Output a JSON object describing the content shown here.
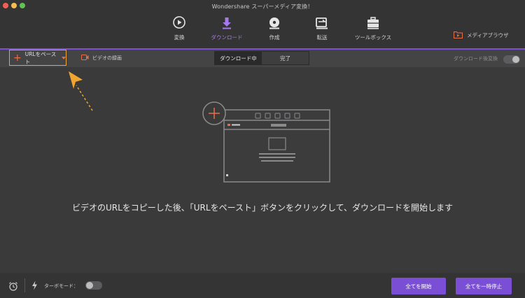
{
  "window": {
    "title": "Wondershare スーパーメディア変換！"
  },
  "tabs": [
    {
      "label": "変換",
      "icon": "convert-icon"
    },
    {
      "label": "ダウンロード",
      "icon": "download-icon",
      "active": true
    },
    {
      "label": "作成",
      "icon": "burn-disc-icon"
    },
    {
      "label": "転送",
      "icon": "transfer-icon"
    },
    {
      "label": "ツールボックス",
      "icon": "toolbox-icon"
    }
  ],
  "media_browser": {
    "label": "メディアブラウザ",
    "icon": "media-browser-icon"
  },
  "toolbar": {
    "paste_url": "URLをペースト",
    "record_video": "ビデオの録画",
    "segments": [
      "ダウンロード中",
      "完了"
    ],
    "active_segment": "ダウンロード中",
    "convert_after_download": "ダウンロード後変換",
    "convert_after_download_on": false
  },
  "main": {
    "instruction": "ビデオのURLをコピーした後、「URLをペースト」ボタンをクリックして、ダウンロードを開始します"
  },
  "footer": {
    "turbo_mode": "ターボモード：",
    "turbo_mode_on": false,
    "start_all": "全てを開始",
    "pause_all": "全てを一時停止"
  },
  "colors": {
    "accent_purple": "#7b4fd5",
    "highlight_orange": "#f1a531",
    "icon_red": "#e86e4a",
    "background": "#3b3a3b"
  }
}
